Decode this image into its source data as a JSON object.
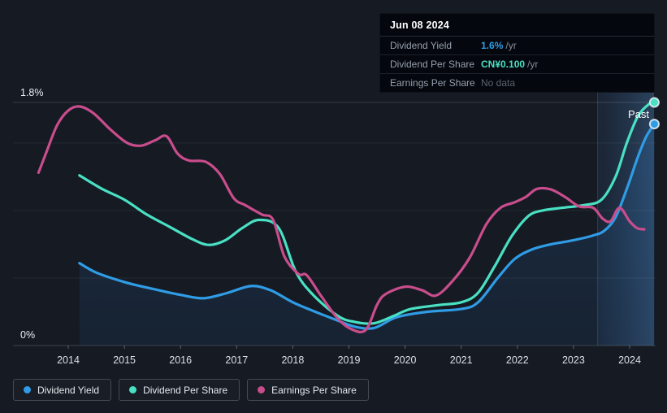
{
  "page": {
    "background": "#151a23"
  },
  "tooltip": {
    "date": "Jun 08 2024",
    "rows": [
      {
        "label": "Dividend Yield",
        "value": "1.6%",
        "unit": "/yr",
        "color": "#2f9ce5"
      },
      {
        "label": "Dividend Per Share",
        "value": "CN¥0.100",
        "unit": "/yr",
        "color": "#49e0c3"
      },
      {
        "label": "Earnings Per Share",
        "value": "No data",
        "unit": "",
        "color": "#5c646f"
      }
    ]
  },
  "legend": {
    "items": [
      {
        "label": "Dividend Yield",
        "color": "#2f9ce5"
      },
      {
        "label": "Dividend Per Share",
        "color": "#49e0c3"
      },
      {
        "label": "Earnings Per Share",
        "color": "#c94d8c"
      }
    ]
  },
  "past_label": "Past",
  "chart_data": {
    "type": "line",
    "title": "Dividend history",
    "y_axis": {
      "min": 0,
      "max": 1.8,
      "top_tick": {
        "label": "1.8%",
        "value": 1.8
      },
      "bottom_tick": {
        "label": "0%",
        "value": 0
      },
      "gridline_values": [
        0.5,
        1.0,
        1.5
      ],
      "grid": true
    },
    "x_axis": {
      "tick_years": [
        2014,
        2015,
        2016,
        2017,
        2018,
        2019,
        2020,
        2021,
        2022,
        2023,
        2024
      ],
      "tick_labels": [
        "2014",
        "2015",
        "2016",
        "2017",
        "2018",
        "2019",
        "2020",
        "2021",
        "2022",
        "2023",
        "2024"
      ]
    },
    "past_band": {
      "start_year": 2023.43,
      "end_year": 2024.435
    },
    "legend_position": "bottom-left",
    "series": [
      {
        "name": "Dividend Yield",
        "color": "#2f9ce5",
        "area": true,
        "end_dot": true,
        "points": [
          [
            2014.2,
            0.61
          ],
          [
            2014.5,
            0.54
          ],
          [
            2015.0,
            0.47
          ],
          [
            2015.5,
            0.42
          ],
          [
            2016.0,
            0.375
          ],
          [
            2016.4,
            0.35
          ],
          [
            2016.8,
            0.385
          ],
          [
            2017.25,
            0.44
          ],
          [
            2017.6,
            0.41
          ],
          [
            2018.0,
            0.32
          ],
          [
            2018.4,
            0.25
          ],
          [
            2018.8,
            0.185
          ],
          [
            2019.1,
            0.14
          ],
          [
            2019.45,
            0.13
          ],
          [
            2019.85,
            0.21
          ],
          [
            2020.4,
            0.25
          ],
          [
            2021.0,
            0.27
          ],
          [
            2021.3,
            0.32
          ],
          [
            2021.65,
            0.5
          ],
          [
            2021.95,
            0.64
          ],
          [
            2022.25,
            0.71
          ],
          [
            2022.55,
            0.745
          ],
          [
            2023.0,
            0.78
          ],
          [
            2023.35,
            0.815
          ],
          [
            2023.55,
            0.85
          ],
          [
            2023.75,
            0.95
          ],
          [
            2023.95,
            1.16
          ],
          [
            2024.15,
            1.4
          ],
          [
            2024.3,
            1.55
          ],
          [
            2024.44,
            1.64
          ]
        ]
      },
      {
        "name": "Dividend Per Share",
        "color": "#49e0c3",
        "area": false,
        "end_dot": true,
        "points": [
          [
            2014.2,
            1.26
          ],
          [
            2014.6,
            1.16
          ],
          [
            2015.0,
            1.08
          ],
          [
            2015.4,
            0.97
          ],
          [
            2015.8,
            0.88
          ],
          [
            2016.2,
            0.79
          ],
          [
            2016.5,
            0.745
          ],
          [
            2016.8,
            0.78
          ],
          [
            2017.1,
            0.87
          ],
          [
            2017.4,
            0.93
          ],
          [
            2017.75,
            0.87
          ],
          [
            2018.05,
            0.55
          ],
          [
            2018.35,
            0.38
          ],
          [
            2018.8,
            0.22
          ],
          [
            2019.1,
            0.175
          ],
          [
            2019.45,
            0.165
          ],
          [
            2019.8,
            0.22
          ],
          [
            2020.1,
            0.27
          ],
          [
            2020.6,
            0.3
          ],
          [
            2021.0,
            0.32
          ],
          [
            2021.3,
            0.39
          ],
          [
            2021.6,
            0.59
          ],
          [
            2021.9,
            0.81
          ],
          [
            2022.2,
            0.96
          ],
          [
            2022.45,
            1.0
          ],
          [
            2022.8,
            1.02
          ],
          [
            2023.2,
            1.04
          ],
          [
            2023.5,
            1.08
          ],
          [
            2023.75,
            1.25
          ],
          [
            2023.95,
            1.5
          ],
          [
            2024.15,
            1.7
          ],
          [
            2024.35,
            1.79
          ],
          [
            2024.44,
            1.8
          ]
        ]
      },
      {
        "name": "Earnings Per Share",
        "color": "#c94d8c",
        "area": false,
        "end_dot": false,
        "points": [
          [
            2013.47,
            1.28
          ],
          [
            2013.6,
            1.42
          ],
          [
            2013.8,
            1.63
          ],
          [
            2014.0,
            1.74
          ],
          [
            2014.2,
            1.77
          ],
          [
            2014.45,
            1.72
          ],
          [
            2014.75,
            1.6
          ],
          [
            2015.05,
            1.5
          ],
          [
            2015.3,
            1.48
          ],
          [
            2015.55,
            1.52
          ],
          [
            2015.75,
            1.55
          ],
          [
            2015.95,
            1.42
          ],
          [
            2016.15,
            1.37
          ],
          [
            2016.45,
            1.36
          ],
          [
            2016.7,
            1.27
          ],
          [
            2016.95,
            1.09
          ],
          [
            2017.15,
            1.04
          ],
          [
            2017.45,
            0.97
          ],
          [
            2017.65,
            0.93
          ],
          [
            2017.85,
            0.66
          ],
          [
            2018.1,
            0.53
          ],
          [
            2018.25,
            0.52
          ],
          [
            2018.5,
            0.37
          ],
          [
            2018.8,
            0.2
          ],
          [
            2019.05,
            0.12
          ],
          [
            2019.3,
            0.115
          ],
          [
            2019.5,
            0.3
          ],
          [
            2019.65,
            0.38
          ],
          [
            2020.0,
            0.435
          ],
          [
            2020.3,
            0.41
          ],
          [
            2020.55,
            0.37
          ],
          [
            2020.85,
            0.48
          ],
          [
            2021.15,
            0.65
          ],
          [
            2021.45,
            0.9
          ],
          [
            2021.7,
            1.02
          ],
          [
            2021.95,
            1.06
          ],
          [
            2022.15,
            1.1
          ],
          [
            2022.35,
            1.16
          ],
          [
            2022.6,
            1.155
          ],
          [
            2022.85,
            1.1
          ],
          [
            2023.1,
            1.03
          ],
          [
            2023.35,
            1.02
          ],
          [
            2023.52,
            0.94
          ],
          [
            2023.66,
            0.92
          ],
          [
            2023.82,
            1.02
          ],
          [
            2024.0,
            0.92
          ],
          [
            2024.13,
            0.87
          ],
          [
            2024.26,
            0.86
          ]
        ]
      }
    ]
  }
}
